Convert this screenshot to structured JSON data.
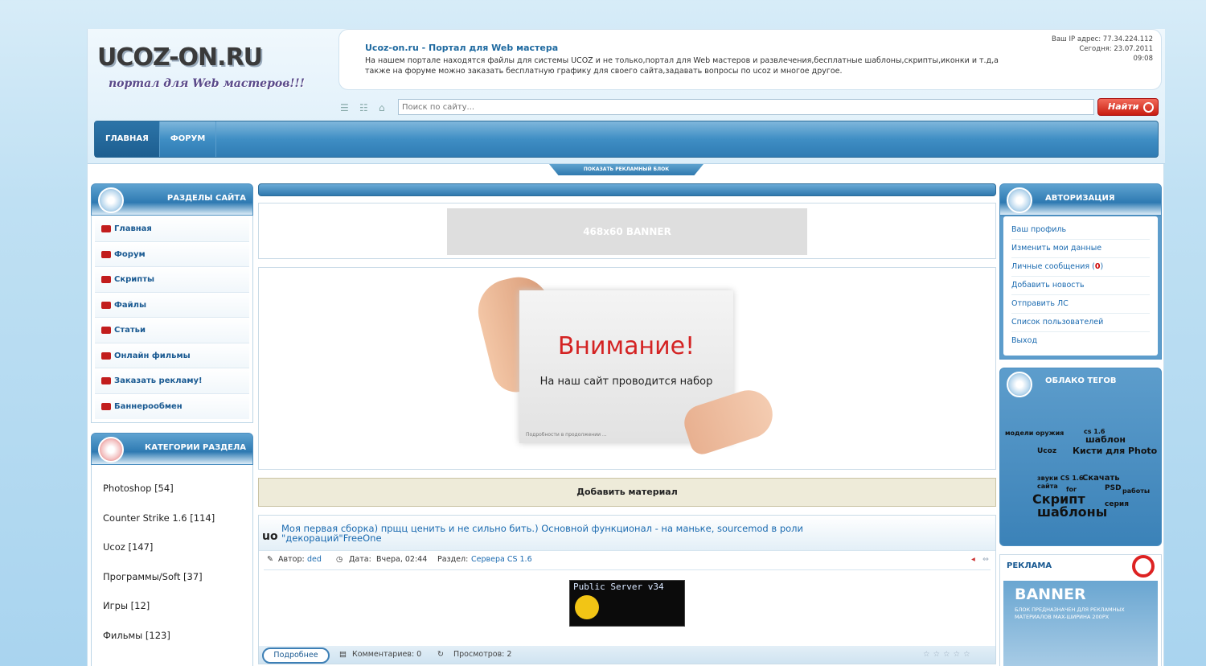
{
  "header": {
    "logo": "UCOZ-ON.RU",
    "slogan": "портал для Web мастеров!!!",
    "site_title": "Ucoz-on.ru - Портал для Web мастера",
    "site_desc": "На нашем портале находятся файлы для системы UCOZ и не только,портал для Web мастеров и развлечения,бесплатные шаблоны,скрипты,иконки и т.д,а также на форуме можно заказать бесплатную графику для своего сайта,задавать вопросы по ucoz и многое другое.",
    "ip_line": "Ваш IP адрес: 77.34.224.112",
    "date_line": "Сегодня: 23.07.2011",
    "time_line": "09:08"
  },
  "search": {
    "placeholder": "Поиск по сайту...",
    "button": "Найти"
  },
  "nav": [
    {
      "label": "ГЛАВНАЯ"
    },
    {
      "label": "ФОРУМ"
    }
  ],
  "ad_tab": "ПОКАЗАТЬ РЕКЛАМНЫЙ БЛОК",
  "sections": {
    "title": "РАЗДЕЛЫ САЙТА",
    "items": [
      "Главная",
      "Форум",
      "Скрипты",
      "Файлы",
      "Статьи",
      "Онлайн фильмы",
      "Заказать рекламу!",
      "Баннерообмен"
    ]
  },
  "categories": {
    "title": "КАТЕГОРИИ РАЗДЕЛА",
    "items": [
      "Photoshop [54]",
      "Counter Strike 1.6 [114]",
      "Ucoz [147]",
      "Программы/Soft [37]",
      "Игры [12]",
      "Фильмы [123]"
    ]
  },
  "main": {
    "banner": "468x60 BANNER",
    "attention_title": "Внимание!",
    "attention_text": "На наш сайт проводится набор",
    "attention_more": "Подробности в продолжении ...",
    "add_material": "Добавить материал",
    "news": {
      "badge": "uo",
      "title": "Моя первая сборка) прщц ценить и не сильно бить.) Основной функционал - на маньке, sourcemod в роли \"декораций\"FreeOne",
      "author_label": "Автор:",
      "author": "ded",
      "date_label": "Дата:",
      "date": "Вчера, 02:44",
      "section_label": "Раздел:",
      "section": "Сервера CS 1.6",
      "image_text": "Public Server v34",
      "more": "Подробнее",
      "comments": "Комментариев: 0",
      "views": "Просмотров: 2"
    }
  },
  "auth": {
    "title": "АВТОРИЗАЦИЯ",
    "items": [
      "Ваш профиль",
      "Изменить мои данные",
      "Личные сообщения",
      "Добавить новость",
      "Отправить ЛС",
      "Список пользователей",
      "Выход"
    ],
    "pm_count": "0"
  },
  "tags": {
    "title": "ОБЛАКО ТЕГОВ",
    "words": [
      "модели оружия",
      "cs 1.6",
      "шаблон",
      "Ucoz",
      "Кисти для Photo",
      "звуки CS 1.6",
      "Скачать",
      "сайта",
      "for",
      "PSD",
      "работы",
      "Скрипт",
      "серия",
      "шаблоны"
    ]
  },
  "ads": {
    "title": "РЕКЛАМА",
    "banner": "BANNER",
    "banner_text": "БЛОК ПРЕДНАЗНАЧЕН ДЛЯ РЕКЛАМНЫХ МАТЕРИАЛОВ MAX-ШИРИНА 200PX"
  }
}
